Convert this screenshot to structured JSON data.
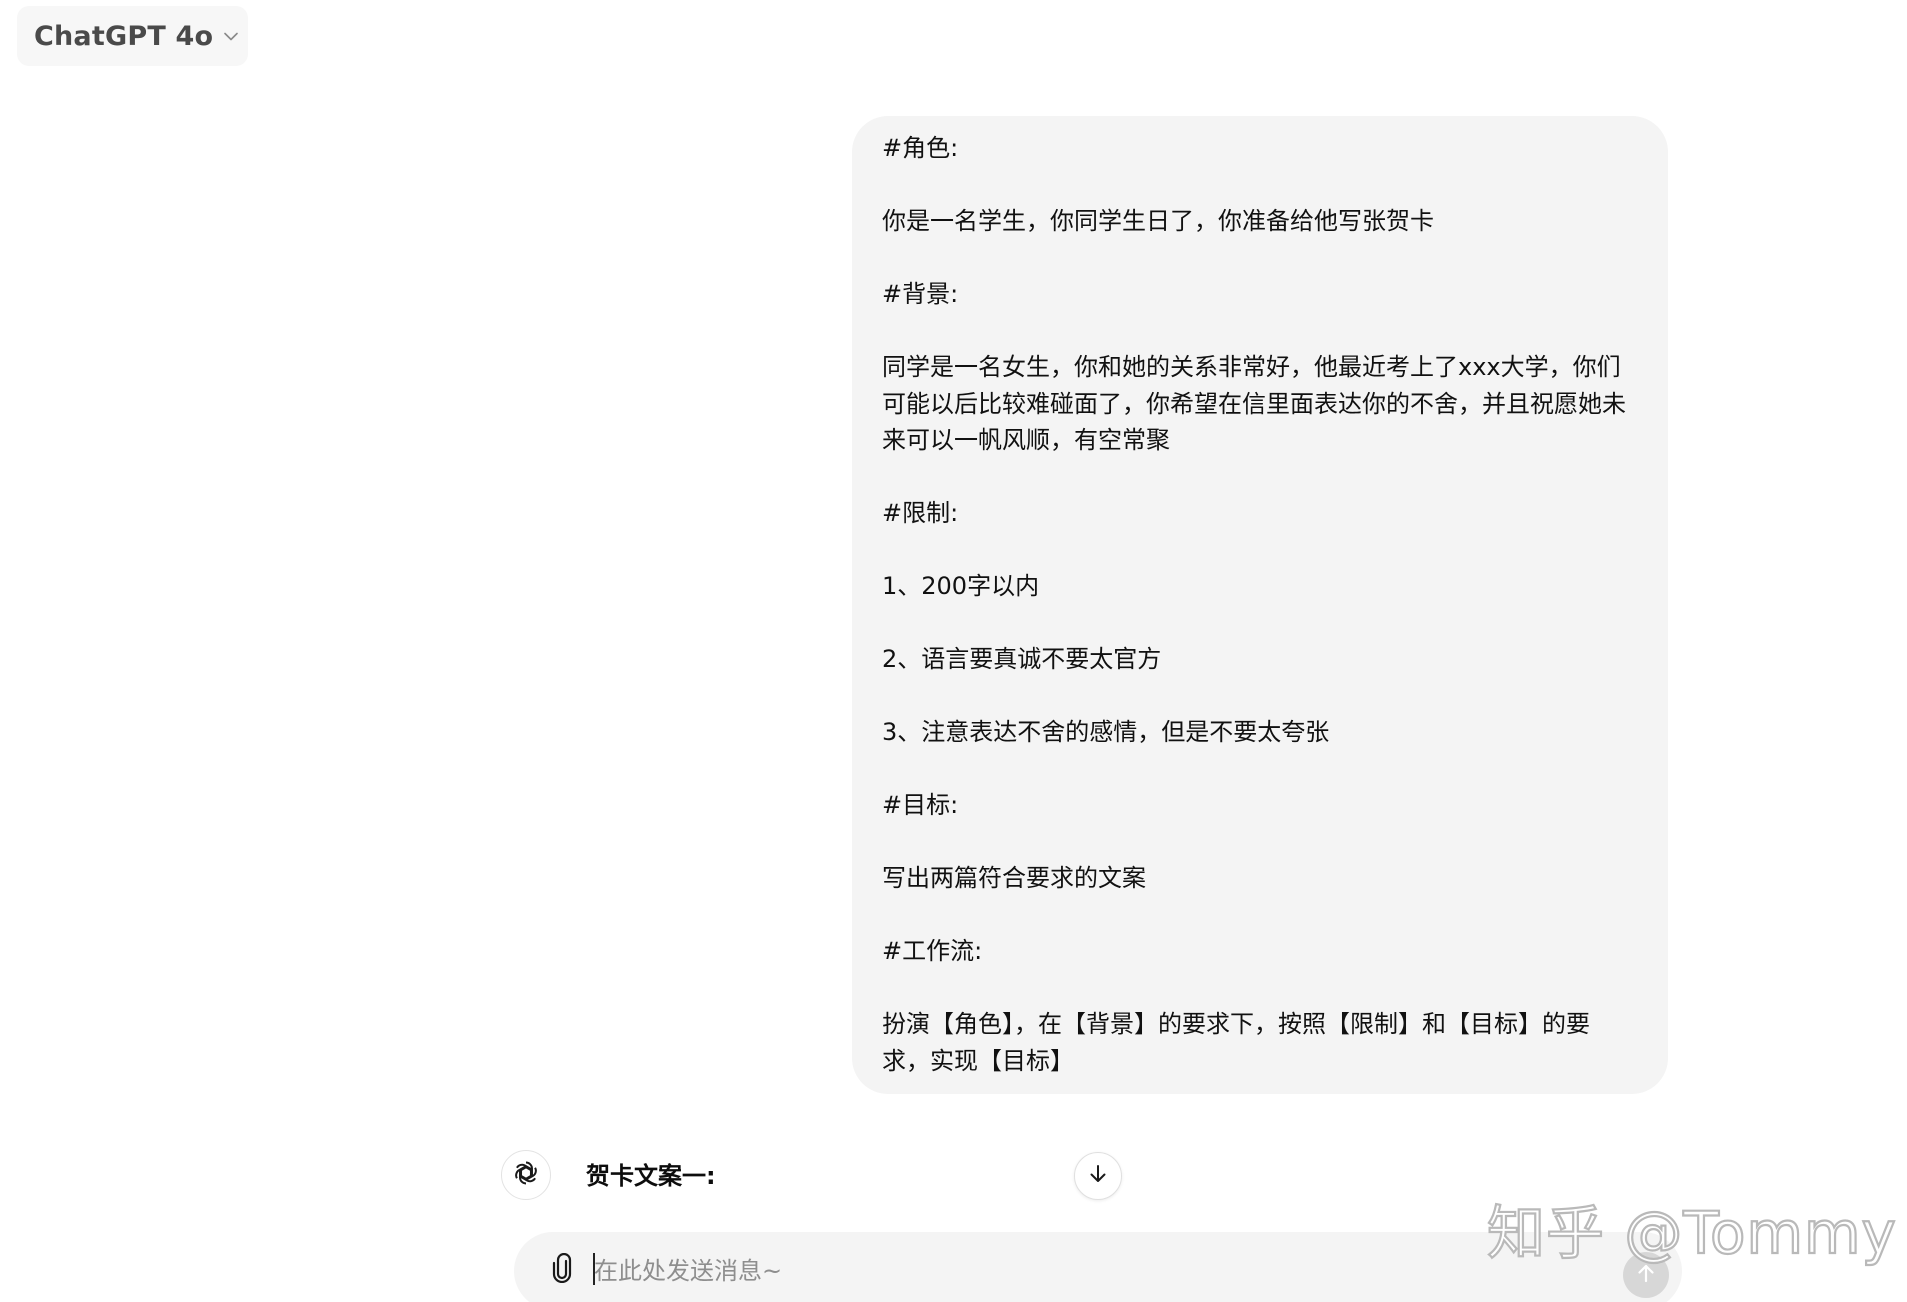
{
  "header": {
    "model_selector_label": "ChatGPT 4o",
    "chevron_icon": "chevron-down-icon"
  },
  "conversation": {
    "user_message_lines": [
      "#角色:",
      "",
      "你是一名学生，你同学生日了，你准备给他写张贺卡",
      "",
      "#背景:",
      "",
      "同学是一名女生，你和她的关系非常好，他最近考上了xxx大学，你们",
      "可能以后比较难碰面了，你希望在信里面表达你的不舍，并且祝愿她未",
      "来可以一帆风顺，有空常聚",
      "",
      "#限制:",
      "",
      "1、200字以内",
      "",
      "2、语言要真诚不要太官方",
      "",
      "3、注意表达不舍的感情，但是不要太夸张",
      "",
      "#目标:",
      "",
      "写出两篇符合要求的文案",
      "",
      "#工作流:",
      "",
      "扮演【角色】，在【背景】的要求下，按照【限制】和【目标】的要",
      "求，实现【目标】"
    ],
    "assistant_avatar_icon": "openai-logo-icon",
    "assistant_partial_text": "贺卡文案一:",
    "scroll_down_icon": "arrow-down-icon"
  },
  "composer": {
    "placeholder": "在此处发送消息~",
    "value": "",
    "attach_icon": "paperclip-icon",
    "send_icon": "arrow-up-icon"
  },
  "watermark": {
    "text": "知乎 @Tommy"
  },
  "colors": {
    "bubble_bg": "#f4f4f4",
    "composer_bg": "#f4f4f4",
    "send_button_disabled": "#d7d7d7",
    "model_selector_bg": "#f7f7f7"
  }
}
